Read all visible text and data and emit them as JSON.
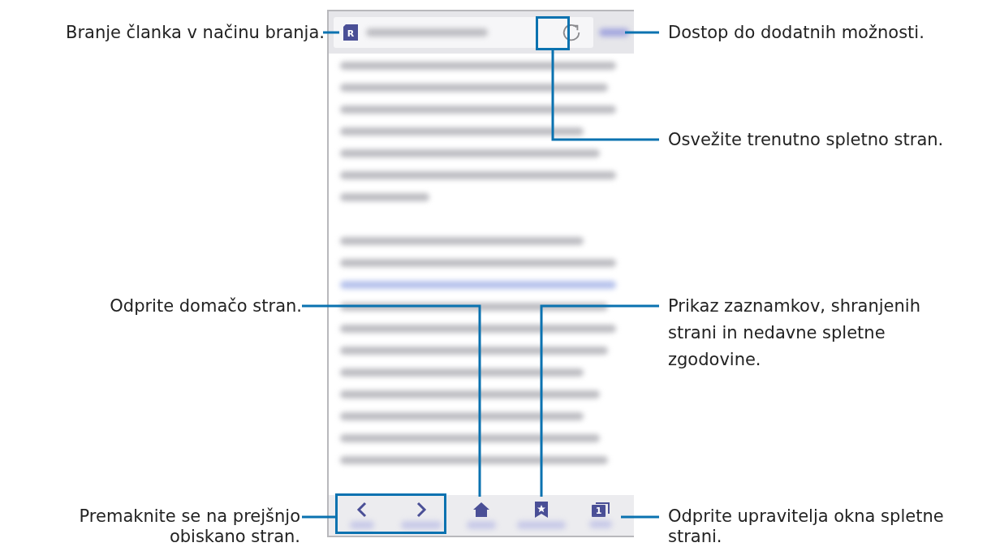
{
  "callouts": [
    {
      "text": "Branje članka v načinu branja."
    },
    {
      "text": "Dostop do dodatnih možnosti."
    },
    {
      "text": "Osvežite trenutno spletno stran."
    },
    {
      "text": "Odprite domačo stran."
    },
    {
      "text": "Prikaz zaznamkov, shranjenih strani in nedavne spletne zgodovine."
    },
    {
      "text": "Premaknite se na prejšnjo obiskano stran."
    },
    {
      "text": "Odprite upravitelja okna spletne strani."
    }
  ],
  "phone": {
    "reader_badge": "R",
    "tab_count": "1"
  }
}
